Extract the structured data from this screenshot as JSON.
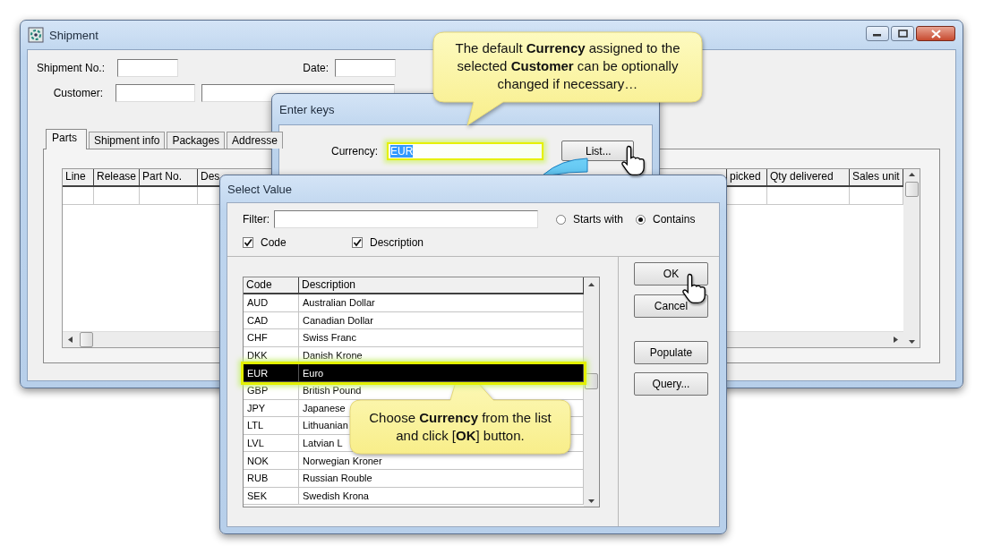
{
  "shipment_window": {
    "title": "Shipment",
    "fields": [
      {
        "label": "Shipment No.:"
      },
      {
        "label": "Date:"
      },
      {
        "label": "Customer:"
      }
    ],
    "tabs": [
      {
        "label": "Parts",
        "selected": true
      },
      {
        "label": "Shipment info",
        "selected": false
      },
      {
        "label": "Packages",
        "selected": false
      },
      {
        "label": "Addresse",
        "selected": false
      }
    ],
    "grid": {
      "columns": [
        "Line",
        "Release",
        "Part No.",
        "Des",
        "picked",
        "Qty delivered",
        "Sales unit"
      ]
    }
  },
  "enter_keys_dialog": {
    "title": "Enter keys",
    "field": {
      "label": "Currency:",
      "value": "EUR"
    },
    "button": "List..."
  },
  "select_value_dialog": {
    "title": "Select Value",
    "filter": {
      "label": "Filter:"
    },
    "match_modes": [
      {
        "label": "Starts with",
        "selected": false
      },
      {
        "label": "Contains",
        "selected": true
      }
    ],
    "search_in": [
      {
        "label": "Code",
        "checked": true
      },
      {
        "label": "Description",
        "checked": true
      }
    ],
    "list": {
      "columns": [
        "Code",
        "Description"
      ],
      "rows": [
        {
          "code": "AUD",
          "description": "Australian Dollar",
          "selected": false
        },
        {
          "code": "CAD",
          "description": "Canadian Dollar",
          "selected": false
        },
        {
          "code": "CHF",
          "description": "Swiss Franc",
          "selected": false
        },
        {
          "code": "DKK",
          "description": "Danish Krone",
          "selected": false
        },
        {
          "code": "EUR",
          "description": "Euro",
          "selected": true
        },
        {
          "code": "GBP",
          "description": "British Pound",
          "selected": false
        },
        {
          "code": "JPY",
          "description": "Japanese",
          "selected": false
        },
        {
          "code": "LTL",
          "description": "Lithuanian",
          "selected": false
        },
        {
          "code": "LVL",
          "description": "Latvian L",
          "selected": false
        },
        {
          "code": "NOK",
          "description": "Norwegian Kroner",
          "selected": false
        },
        {
          "code": "RUB",
          "description": "Russian Rouble",
          "selected": false
        },
        {
          "code": "SEK",
          "description": "Swedish Krona",
          "selected": false
        }
      ]
    },
    "buttons": [
      "OK",
      "Cancel",
      "Populate",
      "Query..."
    ]
  },
  "callouts": [
    {
      "text": "The default **Currency** assigned to the selected **Customer** can be optionally changed if necessary…"
    },
    {
      "text": "Choose **Currency** from the list and click [**OK**] button."
    }
  ]
}
